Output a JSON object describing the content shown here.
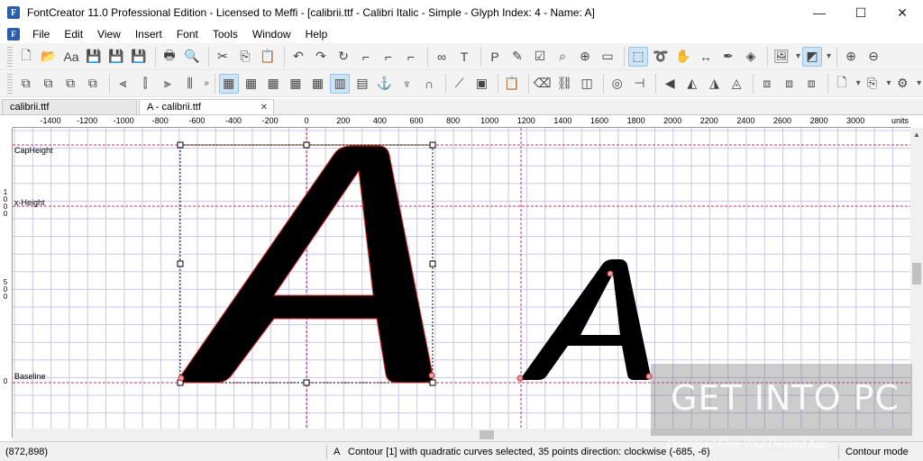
{
  "window": {
    "title": "FontCreator 11.0 Professional Edition - Licensed to Meffi - [calibrii.ttf - Calibri Italic - Simple - Glyph Index: 4 - Name: A]",
    "minimize": "—",
    "maximize": "☐",
    "close": "✕",
    "app_icon": "F"
  },
  "menu": {
    "items": [
      "File",
      "Edit",
      "View",
      "Insert",
      "Font",
      "Tools",
      "Window",
      "Help"
    ]
  },
  "tabs": [
    {
      "label": "calibrii.ttf"
    },
    {
      "label": "A - calibrii.ttf",
      "close": "✕"
    }
  ],
  "ruler": {
    "ticks": [
      "-1400",
      "-1200",
      "-1000",
      "-800",
      "-600",
      "-400",
      "-200",
      "0",
      "200",
      "400",
      "600",
      "800",
      "1000",
      "1200",
      "1400",
      "1600",
      "1800",
      "2000",
      "2200",
      "2400",
      "2600",
      "2800",
      "3000"
    ],
    "units": "units",
    "vticks": [
      "1000",
      "500",
      "0"
    ]
  },
  "guides": {
    "capheight": "CapHeight",
    "xheight": "x-Height",
    "baseline": "Baseline"
  },
  "status": {
    "coords": "(872,898)",
    "glyph": "A",
    "message": "Contour [1] with quadratic curves selected, 35 points direction: clockwise (-685, -6)",
    "mode": "Contour mode"
  },
  "watermark": {
    "text": "GET INTO PC",
    "sub": "Download Free Your Desired App"
  },
  "colors": {
    "grid": "#c8c8e8",
    "guide": "#c0306a",
    "glyph": "#000000",
    "outline": "#e03030"
  }
}
